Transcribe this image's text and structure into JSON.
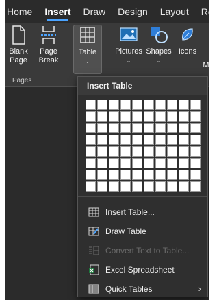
{
  "tabs": [
    "Home",
    "Insert",
    "Draw",
    "Design",
    "Layout",
    "Ref"
  ],
  "active_tab": "Insert",
  "ribbon": {
    "blank_page": [
      "Blank",
      "Page"
    ],
    "page_break": [
      "Page",
      "Break"
    ],
    "table": "Table",
    "pictures": "Pictures",
    "shapes": "Shapes",
    "icons": "Icons",
    "cut_off": "M",
    "group_pages": "Pages"
  },
  "dropdown": {
    "title": "Insert Table",
    "grid_rows": 8,
    "grid_cols": 10,
    "items": [
      {
        "label": "Insert Table...",
        "icon": "insert-table-icon",
        "enabled": true
      },
      {
        "label": "Draw Table",
        "icon": "draw-table-icon",
        "enabled": true
      },
      {
        "label": "Convert Text to Table...",
        "icon": "convert-text-icon",
        "enabled": false
      },
      {
        "label": "Excel Spreadsheet",
        "icon": "excel-icon",
        "enabled": true
      },
      {
        "label": "Quick Tables",
        "icon": "quick-tables-icon",
        "enabled": true,
        "submenu": true
      }
    ]
  },
  "colors": {
    "accent": "#4aa3ff",
    "background": "#2b2b2b",
    "menu": "#2f2f2f"
  }
}
